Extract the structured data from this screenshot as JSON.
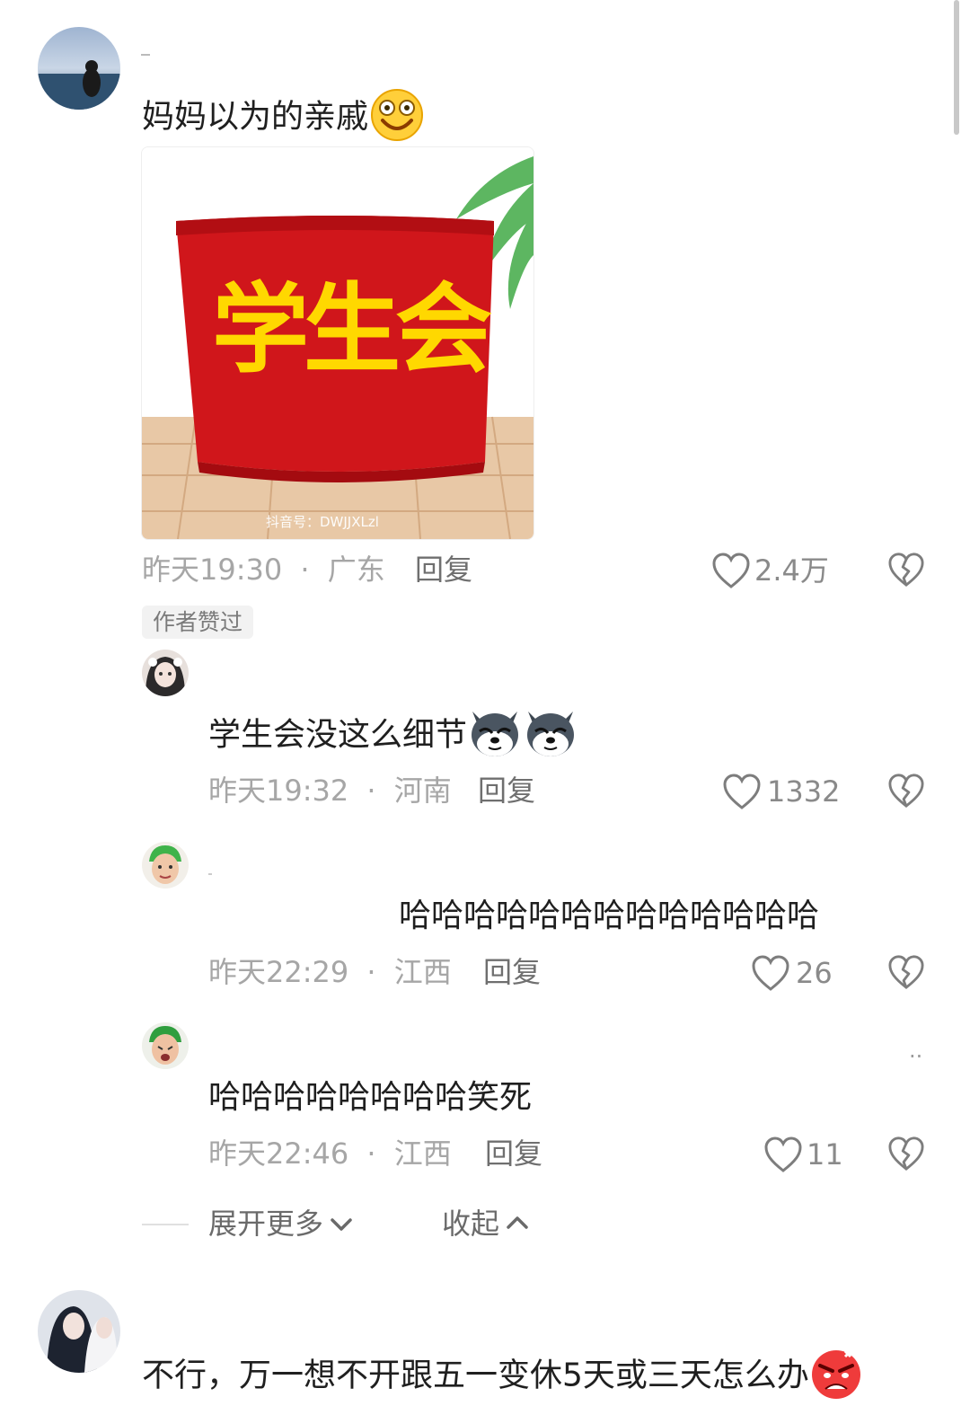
{
  "comments": [
    {
      "text": "妈妈以为的亲戚",
      "emoji": "grinning-face-emoji",
      "image": {
        "armband_text": "学生会",
        "watermark": "抖音号：DWJJXLzl"
      },
      "time": "昨天19:30",
      "sep": "·",
      "location": "广东",
      "reply_label": "回复",
      "likes": "2.4万",
      "badge": "作者赞过"
    },
    {
      "text": "学生会没这么细节",
      "emoji": "husky-dog-emoji",
      "time": "昨天19:32",
      "sep": "·",
      "location": "河南",
      "reply_label": "回复",
      "likes": "1332"
    },
    {
      "text": "哈哈哈哈哈哈哈哈哈哈哈哈哈",
      "time": "昨天22:29",
      "sep": "·",
      "location": "江西",
      "reply_label": "回复",
      "likes": "26"
    },
    {
      "text": "哈哈哈哈哈哈哈哈笑死",
      "time": "昨天22:46",
      "sep": "·",
      "location": "江西",
      "reply_label": "回复",
      "likes": "11",
      "more_dots": "··"
    },
    {
      "text": "不行，万一想不开跟五一变休5天或三天怎么办",
      "emoji": "angry-face-emoji"
    }
  ],
  "thread_controls": {
    "expand_label": "展开更多",
    "collapse_label": "收起"
  },
  "colors": {
    "meta": "#a6a6a6",
    "armband_red": "#d0161b",
    "armband_text": "#ffd800"
  }
}
